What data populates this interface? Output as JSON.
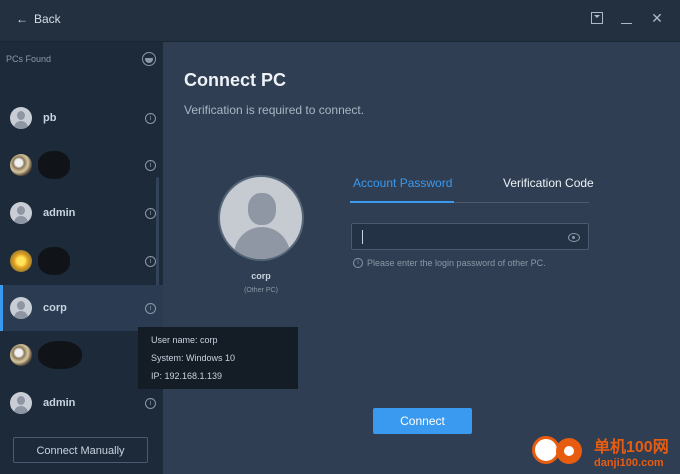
{
  "titlebar": {
    "back_label": "Back"
  },
  "sidebar": {
    "heading": "PCs Found",
    "items": [
      {
        "name": "pb"
      },
      {
        "name": ""
      },
      {
        "name": "admin"
      },
      {
        "name": ""
      },
      {
        "name": "corp"
      },
      {
        "name": ""
      },
      {
        "name": "admin"
      }
    ],
    "connect_manual_label": "Connect Manually"
  },
  "tooltip": {
    "username": "User name: corp",
    "system": "System: Windows 10",
    "ip": "IP: 192.168.1.139"
  },
  "main": {
    "title": "Connect PC",
    "subtitle": "Verification is required to connect.",
    "pc_name": "corp",
    "pc_note": "(Other PC)",
    "tabs": [
      {
        "label": "Account Password"
      },
      {
        "label": "Verification Code"
      }
    ],
    "password_hint": "Please enter the login password of other PC.",
    "connect_label": "Connect"
  },
  "watermark": {
    "line1": "单机100网",
    "line2": "danji100.com"
  },
  "colors": {
    "accent": "#3a9af0",
    "sidebar_bg": "#1d2a3a",
    "main_bg": "#2f3e52"
  }
}
